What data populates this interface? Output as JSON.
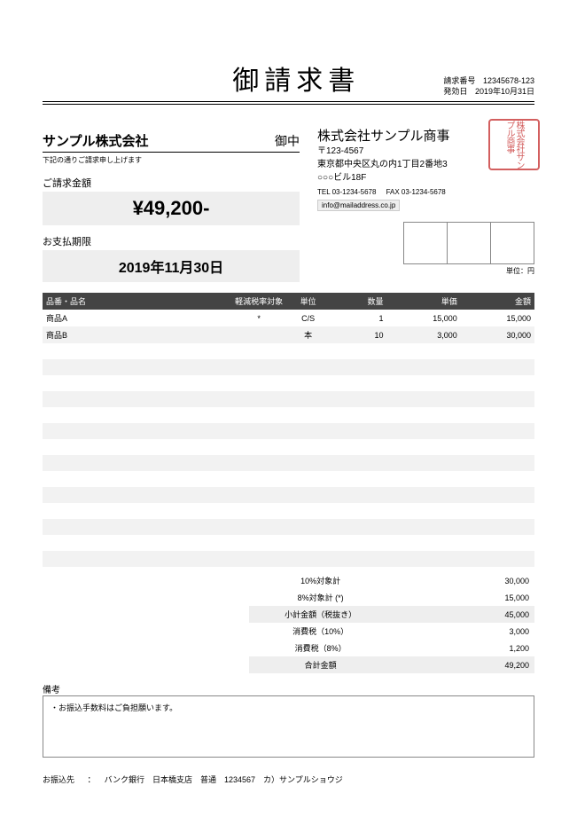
{
  "title": "御請求書",
  "meta": {
    "invoice_no_label": "請求番号",
    "invoice_no": "12345678-123",
    "issue_date_label": "発効日",
    "issue_date": "2019年10月31日"
  },
  "client": {
    "name": "サンプル株式会社",
    "honorific": "御中",
    "note": "下記の通りご請求申し上げます"
  },
  "amount": {
    "label": "ご請求金額",
    "value": "¥49,200-"
  },
  "due": {
    "label": "お支払期限",
    "value": "2019年11月30日"
  },
  "sender": {
    "name": "株式会社サンプル商事",
    "postal": "〒123-4567",
    "address1": "東京都中央区丸の内1丁目2番地3",
    "address2": "○○○ビル18F",
    "tel_label": "TEL",
    "tel": "03-1234-5678",
    "fax_label": "FAX",
    "fax": "03-1234-5678",
    "email": "info@mailaddress.co.jp",
    "seal_text": "株式会社サンプル商事"
  },
  "unit_note": "単位：円",
  "columns": {
    "item": "品番・品名",
    "tax": "軽減税率対象",
    "unit": "単位",
    "qty": "数量",
    "price": "単価",
    "amount": "金額"
  },
  "rows": [
    {
      "item": "商品A",
      "tax": "*",
      "unit": "C/S",
      "qty": "1",
      "price": "15,000",
      "amount": "15,000"
    },
    {
      "item": "商品B",
      "tax": "",
      "unit": "本",
      "qty": "10",
      "price": "3,000",
      "amount": "30,000"
    },
    {
      "item": "",
      "tax": "",
      "unit": "",
      "qty": "",
      "price": "",
      "amount": ""
    },
    {
      "item": "",
      "tax": "",
      "unit": "",
      "qty": "",
      "price": "",
      "amount": ""
    },
    {
      "item": "",
      "tax": "",
      "unit": "",
      "qty": "",
      "price": "",
      "amount": ""
    },
    {
      "item": "",
      "tax": "",
      "unit": "",
      "qty": "",
      "price": "",
      "amount": ""
    },
    {
      "item": "",
      "tax": "",
      "unit": "",
      "qty": "",
      "price": "",
      "amount": ""
    },
    {
      "item": "",
      "tax": "",
      "unit": "",
      "qty": "",
      "price": "",
      "amount": ""
    },
    {
      "item": "",
      "tax": "",
      "unit": "",
      "qty": "",
      "price": "",
      "amount": ""
    },
    {
      "item": "",
      "tax": "",
      "unit": "",
      "qty": "",
      "price": "",
      "amount": ""
    },
    {
      "item": "",
      "tax": "",
      "unit": "",
      "qty": "",
      "price": "",
      "amount": ""
    },
    {
      "item": "",
      "tax": "",
      "unit": "",
      "qty": "",
      "price": "",
      "amount": ""
    },
    {
      "item": "",
      "tax": "",
      "unit": "",
      "qty": "",
      "price": "",
      "amount": ""
    },
    {
      "item": "",
      "tax": "",
      "unit": "",
      "qty": "",
      "price": "",
      "amount": ""
    },
    {
      "item": "",
      "tax": "",
      "unit": "",
      "qty": "",
      "price": "",
      "amount": ""
    },
    {
      "item": "",
      "tax": "",
      "unit": "",
      "qty": "",
      "price": "",
      "amount": ""
    }
  ],
  "summary": [
    {
      "label": "10%対象計",
      "value": "30,000",
      "shade": false
    },
    {
      "label": "8%対象計 (*)",
      "value": "15,000",
      "shade": false
    },
    {
      "label": "小計金額（税抜き）",
      "value": "45,000",
      "shade": true
    },
    {
      "label": "消費税（10%）",
      "value": "3,000",
      "shade": false
    },
    {
      "label": "消費税（8%）",
      "value": "1,200",
      "shade": false
    },
    {
      "label": "合計金額",
      "value": "49,200",
      "shade": true
    }
  ],
  "remarks": {
    "label": "備考",
    "text": "・お振込手数料はご負担願います。"
  },
  "bank": {
    "label": "お振込先",
    "separator": "：",
    "text": "バンク銀行　日本橋支店　普通　1234567　カ）サンプルショウジ"
  }
}
